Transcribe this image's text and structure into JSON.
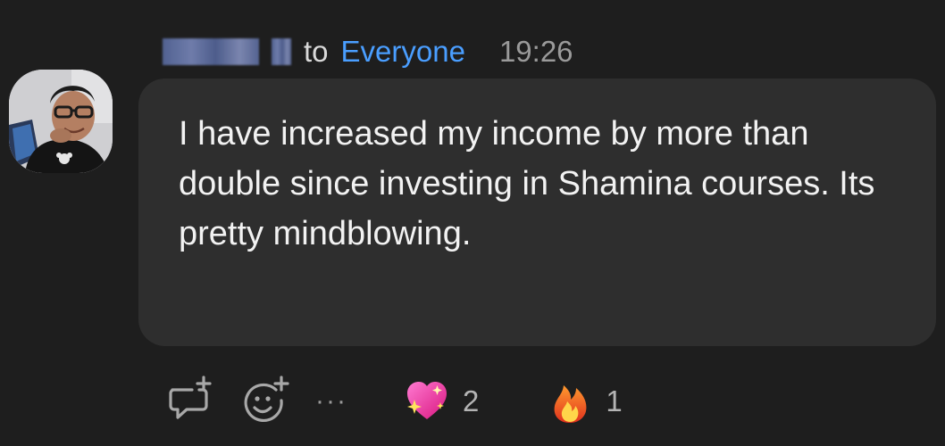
{
  "header": {
    "to_label": "to",
    "recipient": "Everyone",
    "timestamp": "19:26"
  },
  "message": {
    "text": "I have increased my income by more than double since investing in Shamina courses. Its pretty mindblowing."
  },
  "actions": {
    "reply_icon": "reply-add-icon",
    "react_icon": "add-reaction-icon",
    "more_label": "···"
  },
  "reactions": [
    {
      "icon": "sparkling-heart-emoji",
      "count": "2"
    },
    {
      "icon": "fire-emoji",
      "count": "1"
    }
  ],
  "colors": {
    "background": "#1e1e1e",
    "bubble": "#2e2e2e",
    "recipient": "#4a9eff",
    "timestamp": "#9a9a9a"
  }
}
